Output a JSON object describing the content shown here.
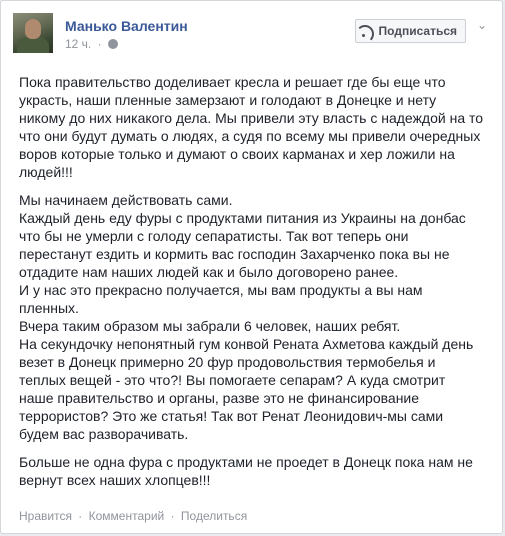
{
  "post": {
    "author": "Манько Валентин",
    "time": "12 ч.",
    "meta_separator": "·",
    "subscribe_label": "Подписаться",
    "chevron": "⌄",
    "paragraphs": [
      "Пока правительство доделивает кресла и решает где бы еще что\nукрасть, наши пленные замерзают и голодают в Донецке и нету\nникому до них никакого дела. Мы привели эту власть с надеждой на то\nчто они будут думать о людях, а судя по всему мы привели очередных\nворов которые только и думают о своих карманах и хер ложили на\nлюдей!!!",
      "Мы начинаем действовать сами.\nКаждый день еду фуры с продуктами питания из Украины на донбас\nчто бы не умерли с голоду сепаратисты. Так вот теперь они\nперестанут ездить и кормить вас господин Захарченко пока вы не\nотдадите нам наших людей как и было договорено ранее.\nИ у нас это прекрасно получается, мы вам продукты а вы нам\nпленных.\nВчера таким образом мы забрали 6 человек, наших ребят.\nНа секундочку непонятный гум конвой Рената Ахметова каждый день\nвезет в Донецк примерно 20 фур продовольствия термобелья и\nтеплых вещей - это что?! Вы помогаете сепарам? А куда смотрит\nнаше правительство и органы, разве это не финансирование\nтеррористов? Это же статья! Так вот Ренат Леонидович-мы сами\nбудем вас разворачивать.",
      "Больше не одна фура с продуктами не проедет в Донецк пока нам не\nвернут всех наших хлопцев!!!"
    ],
    "actions": {
      "like": "Нравится",
      "comment": "Комментарий",
      "share": "Поделиться",
      "separator": "·"
    }
  },
  "icons": {
    "avatar": "avatar",
    "globe": "globe-icon",
    "rss": "rss-icon",
    "chevron": "chevron-down-icon"
  },
  "colors": {
    "link": "#3b5998",
    "meta": "#90949c",
    "text": "#1d2129"
  }
}
